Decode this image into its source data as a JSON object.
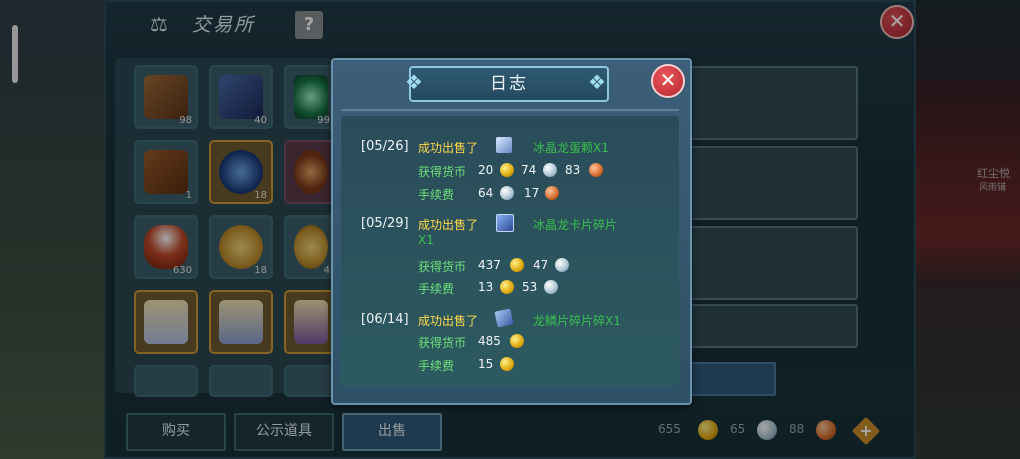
{
  "exchange": {
    "title": "交易所",
    "help_label": "?",
    "close_label": "✕",
    "slots": [
      {
        "count": "98"
      },
      {
        "count": "40"
      },
      {
        "count": "99"
      },
      {
        "count": "1"
      },
      {
        "count": "18"
      },
      {
        "count": ""
      },
      {
        "count": "630"
      },
      {
        "count": "18"
      },
      {
        "count": "4"
      },
      {
        "count": ""
      },
      {
        "count": ""
      },
      {
        "count": ""
      }
    ],
    "buttons": {
      "buy": "购买",
      "show": "公示道具",
      "sell": "出售"
    },
    "currency": {
      "gold": "655",
      "silver": "65",
      "bronze": "88"
    }
  },
  "log": {
    "title": "日志",
    "close_label": "✕",
    "entries": [
      {
        "date": "[05/26]",
        "sold_label": "成功出售了",
        "item": "冰晶龙蛋颗X1",
        "earned_label": "获得货币",
        "earned": [
          "20",
          "74",
          "83"
        ],
        "fee_label": "手续费",
        "fee": [
          "64",
          "17"
        ]
      },
      {
        "date": "[05/29]",
        "sold_label": "成功出售了",
        "item": "冰晶龙卡片碎片",
        "item_line2": "X1",
        "earned_label": "获得货币",
        "earned": [
          "437",
          "47"
        ],
        "fee_label": "手续费",
        "fee": [
          "13",
          "53"
        ]
      },
      {
        "date": "[06/14]",
        "sold_label": "成功出售了",
        "item": "龙鳞片碎片碎X1",
        "earned_label": "获得货币",
        "earned": [
          "485"
        ],
        "fee_label": "手续费",
        "fee": [
          "15"
        ]
      }
    ]
  },
  "world": {
    "right_name": "红尘悦",
    "right_sub": "风雨铺"
  }
}
